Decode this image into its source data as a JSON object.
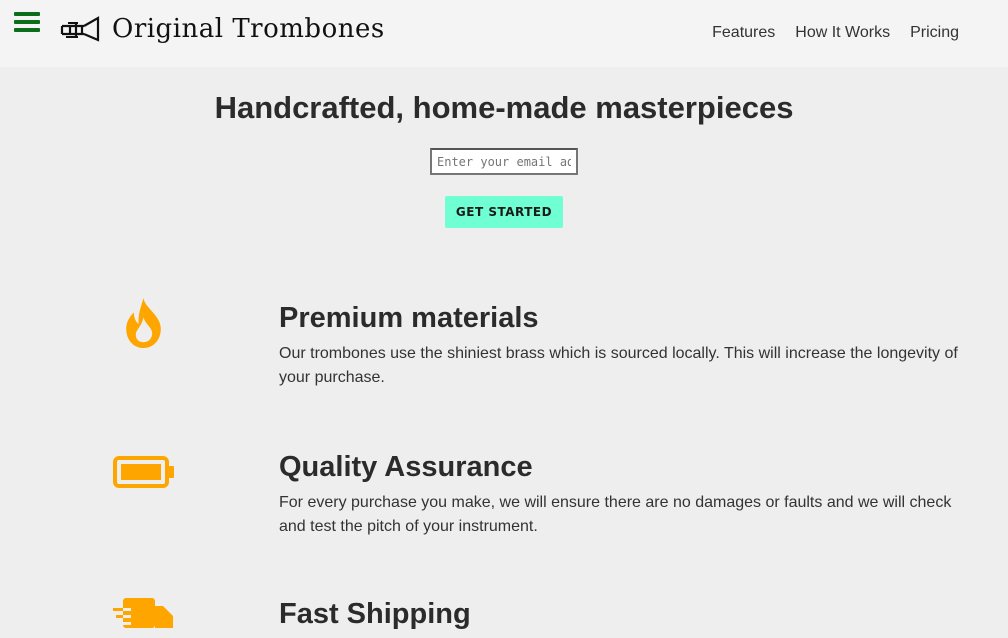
{
  "header": {
    "logo_text": "Original Trombones",
    "nav": [
      "Features",
      "How It Works",
      "Pricing"
    ]
  },
  "hero": {
    "title": "Handcrafted, home-made masterpieces",
    "email_placeholder": "Enter your email address",
    "cta_label": "GET STARTED"
  },
  "features": [
    {
      "icon": "fire-icon",
      "title": "Premium materials",
      "text": "Our trombones use the shiniest brass which is sourced locally. This will increase the longevity of your purchase."
    },
    {
      "icon": "battery-icon",
      "title": "Quality Assurance",
      "text": "For every purchase you make, we will ensure there are no damages or faults and we will check and test the pitch of your instrument."
    },
    {
      "icon": "shipping-truck-icon",
      "title": "Fast Shipping",
      "text": ""
    }
  ],
  "colors": {
    "accent": "#ffa500",
    "cta": "#6fffd2",
    "hamburger": "#0b6e1b",
    "background": "#eeeeee"
  }
}
